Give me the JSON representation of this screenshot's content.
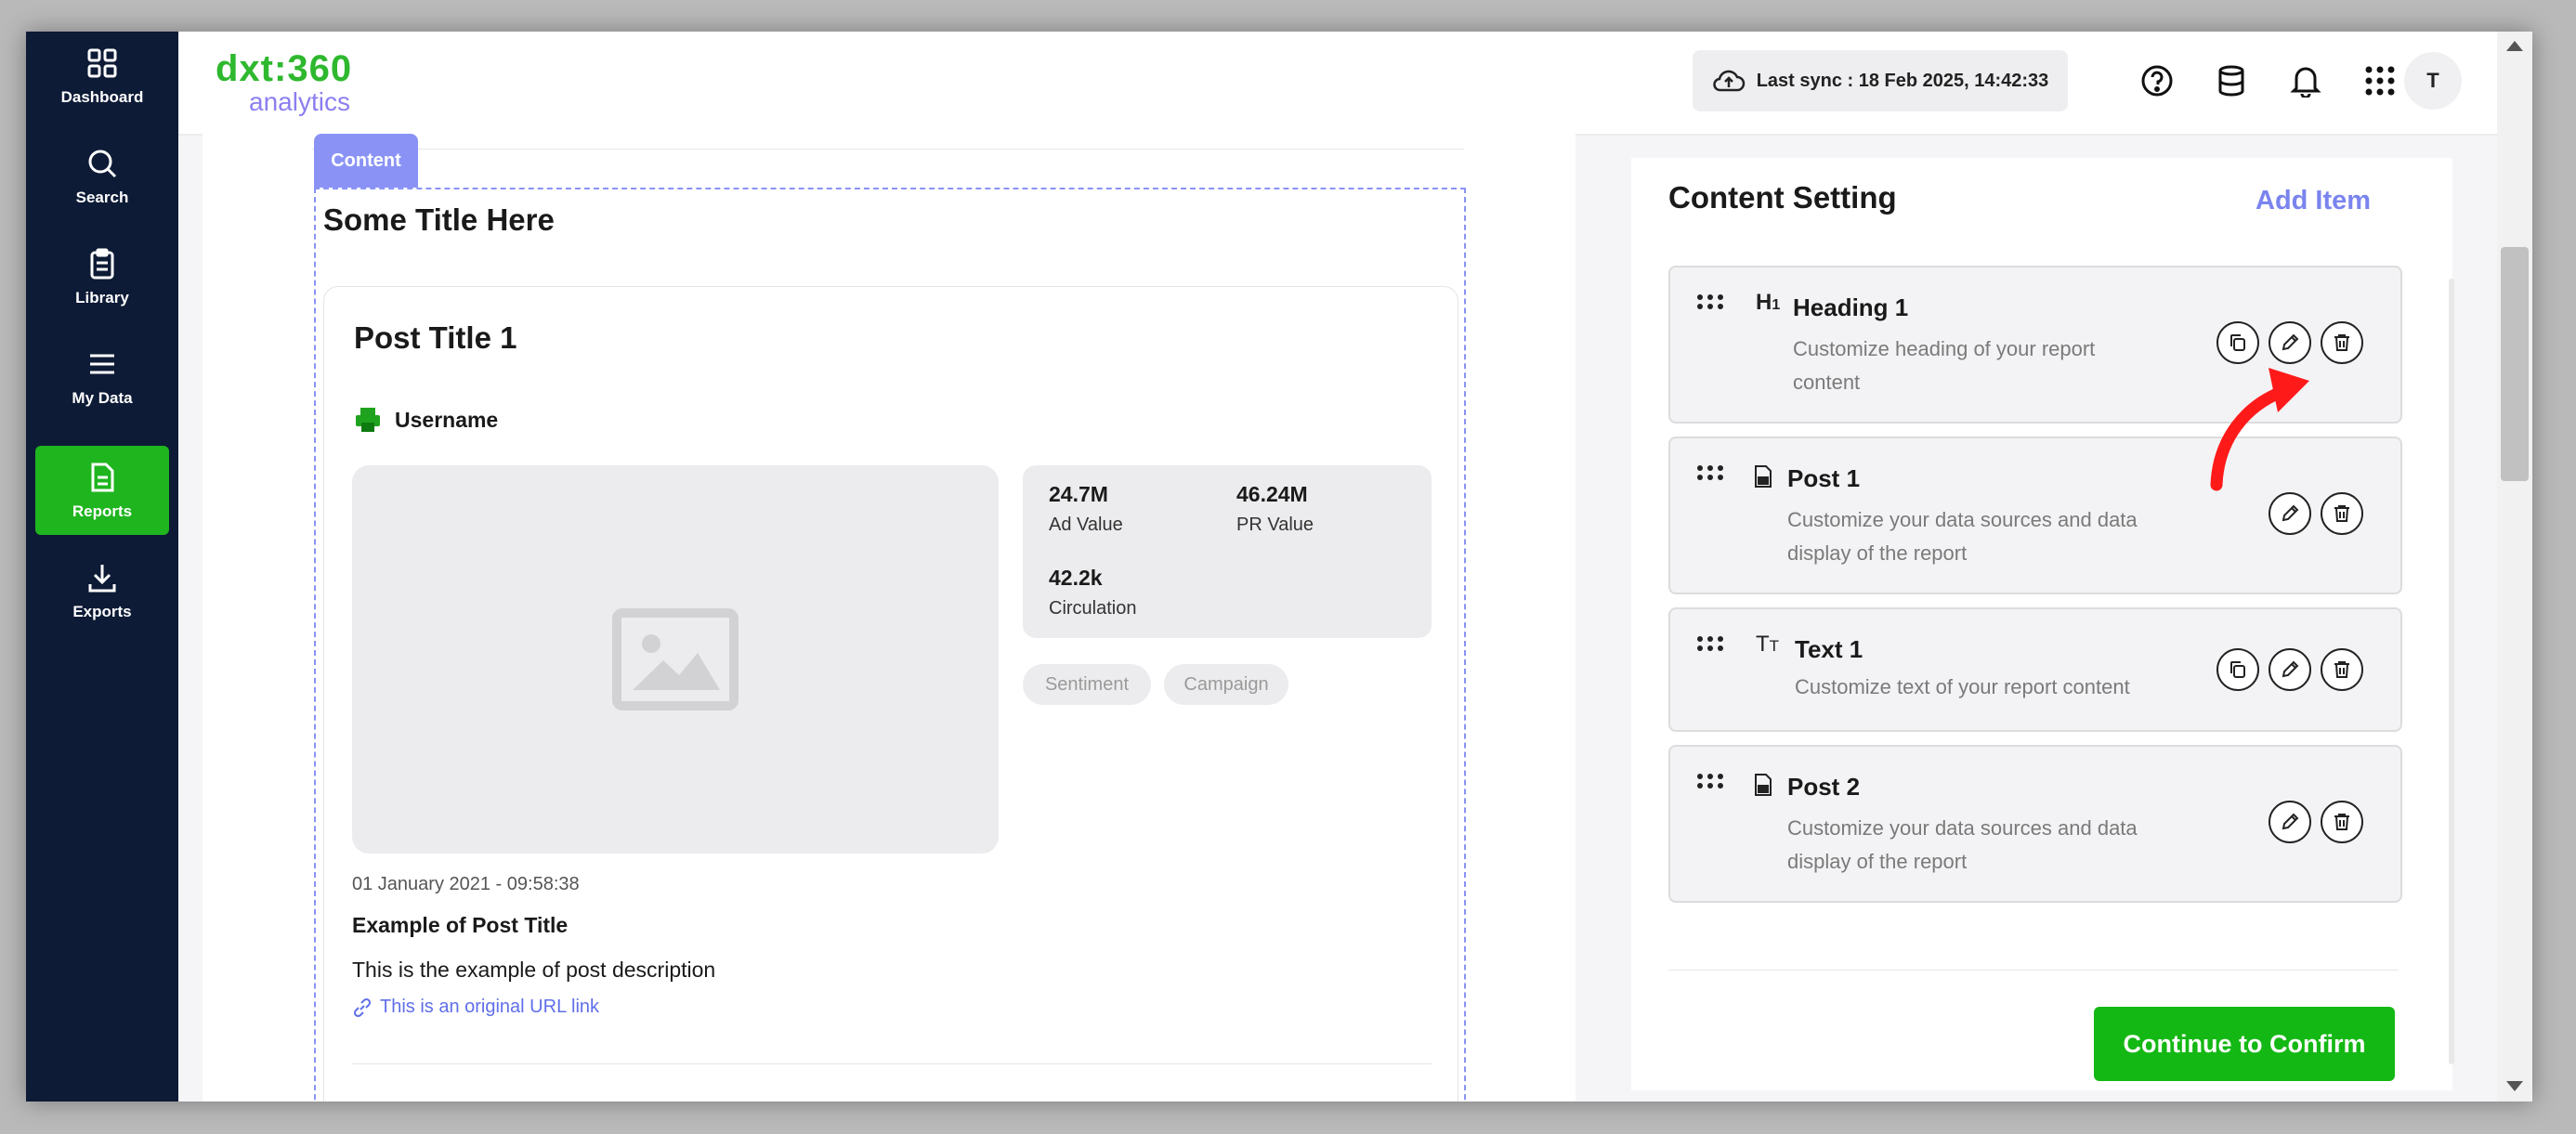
{
  "sidebar": {
    "items": [
      {
        "label": "Dashboard",
        "icon": "grid-icon"
      },
      {
        "label": "Search",
        "icon": "search-icon"
      },
      {
        "label": "Library",
        "icon": "clipboard-icon"
      },
      {
        "label": "My Data",
        "icon": "list-icon"
      },
      {
        "label": "Reports",
        "icon": "document-icon",
        "active": true
      },
      {
        "label": "Exports",
        "icon": "download-icon"
      }
    ],
    "active_color": "#1fb51f"
  },
  "header": {
    "logo_main": "dxt:360",
    "logo_sub": "analytics",
    "sync_text": "Last sync : 18 Feb 2025, 14:42:33",
    "avatar_initial": "T"
  },
  "editor": {
    "tab_label": "Content",
    "section_title": "Some Title Here",
    "post": {
      "title": "Post Title 1",
      "username": "Username",
      "stats": [
        {
          "value": "24.7M",
          "label": "Ad Value"
        },
        {
          "value": "46.24M",
          "label": "PR Value"
        },
        {
          "value": "42.2k",
          "label": "Circulation"
        }
      ],
      "tags": [
        "Sentiment",
        "Campaign"
      ],
      "date": "01 January 2021 - 09:58:38",
      "subtitle": "Example of Post Title",
      "description": "This is the example of post description",
      "link_text": "This is an original URL link"
    }
  },
  "settings": {
    "title": "Content Setting",
    "add_item_label": "Add Item",
    "items": [
      {
        "title": "Heading 1",
        "icon": "H1",
        "desc1": "Customize heading of your report",
        "desc2": "content"
      },
      {
        "title": "Post 1",
        "icon": "post-icon",
        "desc1": "Customize your data sources and data",
        "desc2": "display of the report"
      },
      {
        "title": "Text 1",
        "icon": "TT",
        "desc1": "Customize text of your report content",
        "desc2": ""
      },
      {
        "title": "Post 2",
        "icon": "post-icon",
        "desc1": "Customize your data sources and data",
        "desc2": "display of the report"
      }
    ],
    "confirm_label": "Continue to Confirm",
    "confirm_color": "#14b814",
    "accent_color": "#7a84ee"
  }
}
